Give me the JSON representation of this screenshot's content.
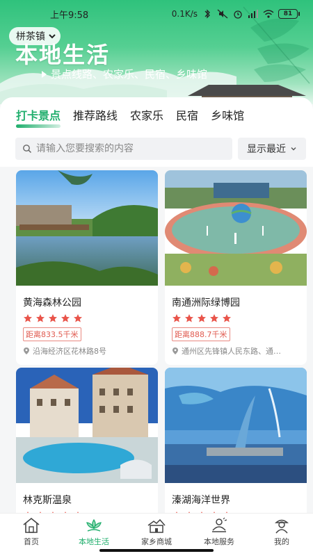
{
  "status_bar": {
    "time": "上午9:58",
    "network_speed": "0.1K/s",
    "battery": "81"
  },
  "header": {
    "location": "栟茶镇",
    "title": "本地生活",
    "subtitle": "景点线路、农家乐、民宿、乡味馆"
  },
  "tabs": [
    {
      "label": "打卡景点",
      "active": true
    },
    {
      "label": "推荐路线",
      "active": false
    },
    {
      "label": "农家乐",
      "active": false
    },
    {
      "label": "民宿",
      "active": false
    },
    {
      "label": "乡味馆",
      "active": false
    }
  ],
  "search": {
    "placeholder": "请输入您要搜索的内容",
    "sort_label": "显示最近"
  },
  "cards": [
    {
      "name": "黄海森林公园",
      "rating": 5,
      "distance": "距离833.5千米",
      "address": "沿海经济区花林路8号"
    },
    {
      "name": "南通洲际绿博园",
      "rating": 5,
      "distance": "距离888.7千米",
      "address": "通州区先锋镇人民东路、通…"
    },
    {
      "name": "林克斯温泉",
      "rating": 5
    },
    {
      "name": "溱湖海洋世界",
      "rating": 5
    }
  ],
  "bottom_nav": [
    {
      "label": "首页",
      "icon": "home-icon",
      "active": false
    },
    {
      "label": "本地生活",
      "icon": "lotus-icon",
      "active": true
    },
    {
      "label": "家乡商城",
      "icon": "shop-icon",
      "active": false
    },
    {
      "label": "本地服务",
      "icon": "service-icon",
      "active": false
    },
    {
      "label": "我的",
      "icon": "profile-icon",
      "active": false
    }
  ],
  "colors": {
    "accent": "#1fae6c",
    "star": "#e9544a",
    "hero": "#2fc27c"
  }
}
